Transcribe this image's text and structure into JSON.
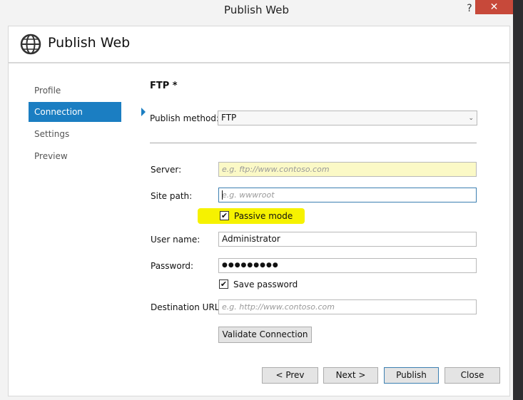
{
  "window": {
    "title": "Publish Web",
    "help_label": "?",
    "close_label": "✕"
  },
  "header": {
    "title": "Publish Web",
    "icon": "globe-icon"
  },
  "nav": {
    "items": [
      {
        "label": "Profile",
        "active": false
      },
      {
        "label": "Connection",
        "active": true
      },
      {
        "label": "Settings",
        "active": false
      },
      {
        "label": "Preview",
        "active": false
      }
    ]
  },
  "form": {
    "section_title": "FTP *",
    "publish_method": {
      "label": "Publish method:",
      "value": "FTP"
    },
    "server": {
      "label": "Server:",
      "value": "",
      "placeholder": "e.g. ftp://www.contoso.com"
    },
    "site_path": {
      "label": "Site path:",
      "value": "",
      "placeholder": "e.g. wwwroot"
    },
    "passive_mode": {
      "label": "Passive mode",
      "checked": true,
      "check": "✔"
    },
    "user_name": {
      "label": "User name:",
      "value": "Administrator"
    },
    "password": {
      "label": "Password:",
      "value": "●●●●●●●●●"
    },
    "save_password": {
      "label": "Save password",
      "checked": true,
      "check": "✔"
    },
    "destination_url": {
      "label": "Destination URL:",
      "value": "",
      "placeholder": "e.g. http://www.contoso.com"
    },
    "validate_label": "Validate Connection"
  },
  "footer": {
    "prev_label": "< Prev",
    "next_label": "Next >",
    "publish_label": "Publish",
    "close_label": "Close"
  },
  "colors": {
    "accent": "#1b7ec2",
    "highlight": "#f6f200",
    "close_button": "#c7493a"
  }
}
